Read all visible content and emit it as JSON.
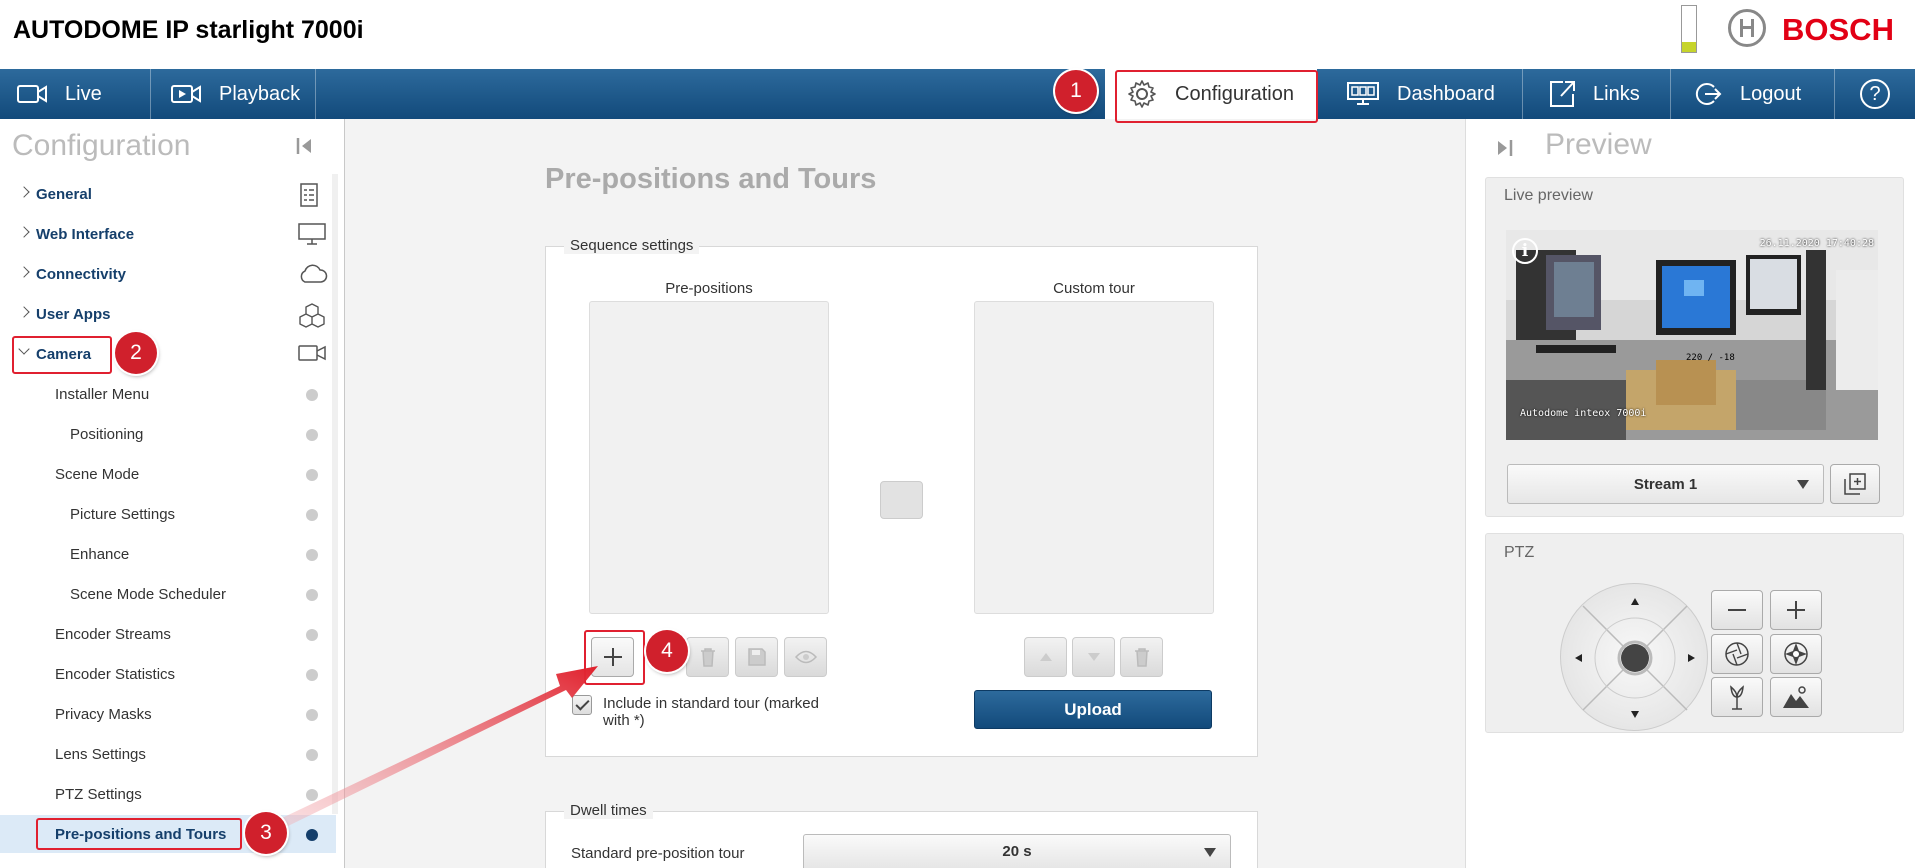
{
  "header": {
    "title": "AUTODOME IP starlight 7000i",
    "brand": "BOSCH",
    "brand_color": "#e20015",
    "level_fraction": 0.22
  },
  "nav": {
    "live": "Live",
    "playback": "Playback",
    "configuration": "Configuration",
    "dashboard": "Dashboard",
    "links": "Links",
    "logout": "Logout",
    "help": "?"
  },
  "sidebar": {
    "title": "Configuration",
    "groups": [
      {
        "label": "General",
        "icon": "document-list-icon"
      },
      {
        "label": "Web Interface",
        "icon": "monitor-icon"
      },
      {
        "label": "Connectivity",
        "icon": "cloud-icon"
      },
      {
        "label": "User Apps",
        "icon": "cubes-icon"
      },
      {
        "label": "Camera",
        "icon": "video-camera-icon"
      }
    ],
    "items": [
      "Installer Menu",
      "Positioning",
      "Scene Mode",
      "Picture Settings",
      "Enhance",
      "Scene Mode Scheduler",
      "Encoder Streams",
      "Encoder Statistics",
      "Privacy Masks",
      "Lens Settings",
      "PTZ Settings",
      "Pre-positions and Tours"
    ]
  },
  "main": {
    "page_title": "Pre-positions and Tours",
    "sequence_legend": "Sequence settings",
    "prepositions_label": "Pre-positions",
    "custom_tour_label": "Custom tour",
    "include_label": "Include in standard tour (marked with *)",
    "upload_label": "Upload",
    "dwell_legend": "Dwell times",
    "standard_tour_label": "Standard pre-position tour",
    "standard_tour_value": "20 s"
  },
  "preview": {
    "title": "Preview",
    "live_preview_title": "Live preview",
    "timestamp": "26.11.2020 17:40:28",
    "camera_name": "Autodome inteox 7000i",
    "overlay_coords": "220 / -18",
    "stream_value": "Stream 1",
    "ptz_title": "PTZ"
  },
  "annotations": {
    "badges": [
      "1",
      "2",
      "3",
      "4"
    ],
    "color": "#d0202c"
  }
}
